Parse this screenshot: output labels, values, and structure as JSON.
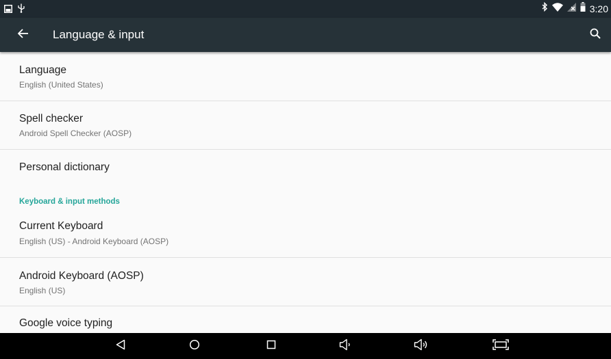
{
  "status_bar": {
    "time": "3:20",
    "left_icons": [
      "screenshot-icon",
      "usb-icon"
    ],
    "right_icons": [
      "bluetooth-icon",
      "wifi-icon",
      "no-signal-icon",
      "battery-icon"
    ]
  },
  "app_bar": {
    "title": "Language & input",
    "back_icon": "arrow-back-icon",
    "search_icon": "search-icon"
  },
  "preferences": [
    {
      "title": "Language",
      "summary": "English (United States)"
    },
    {
      "title": "Spell checker",
      "summary": "Android Spell Checker (AOSP)"
    },
    {
      "title": "Personal dictionary",
      "summary": ""
    }
  ],
  "keyboard_category": {
    "title": "Keyboard & input methods",
    "items": [
      {
        "title": "Current Keyboard",
        "summary": "English (US) - Android Keyboard (AOSP)"
      },
      {
        "title": "Android Keyboard (AOSP)",
        "summary": "English (US)"
      },
      {
        "title": "Google voice typing",
        "summary": ""
      }
    ]
  },
  "nav_bar": {
    "buttons": [
      "back-icon",
      "home-icon",
      "recents-icon",
      "volume-down-icon",
      "volume-up-icon",
      "screenshot-capture-icon"
    ]
  },
  "colors": {
    "status_bar": "#1f2930",
    "app_bar": "#263238",
    "background": "#fafafa",
    "accent": "#26a69a",
    "nav_bar": "#000000"
  }
}
